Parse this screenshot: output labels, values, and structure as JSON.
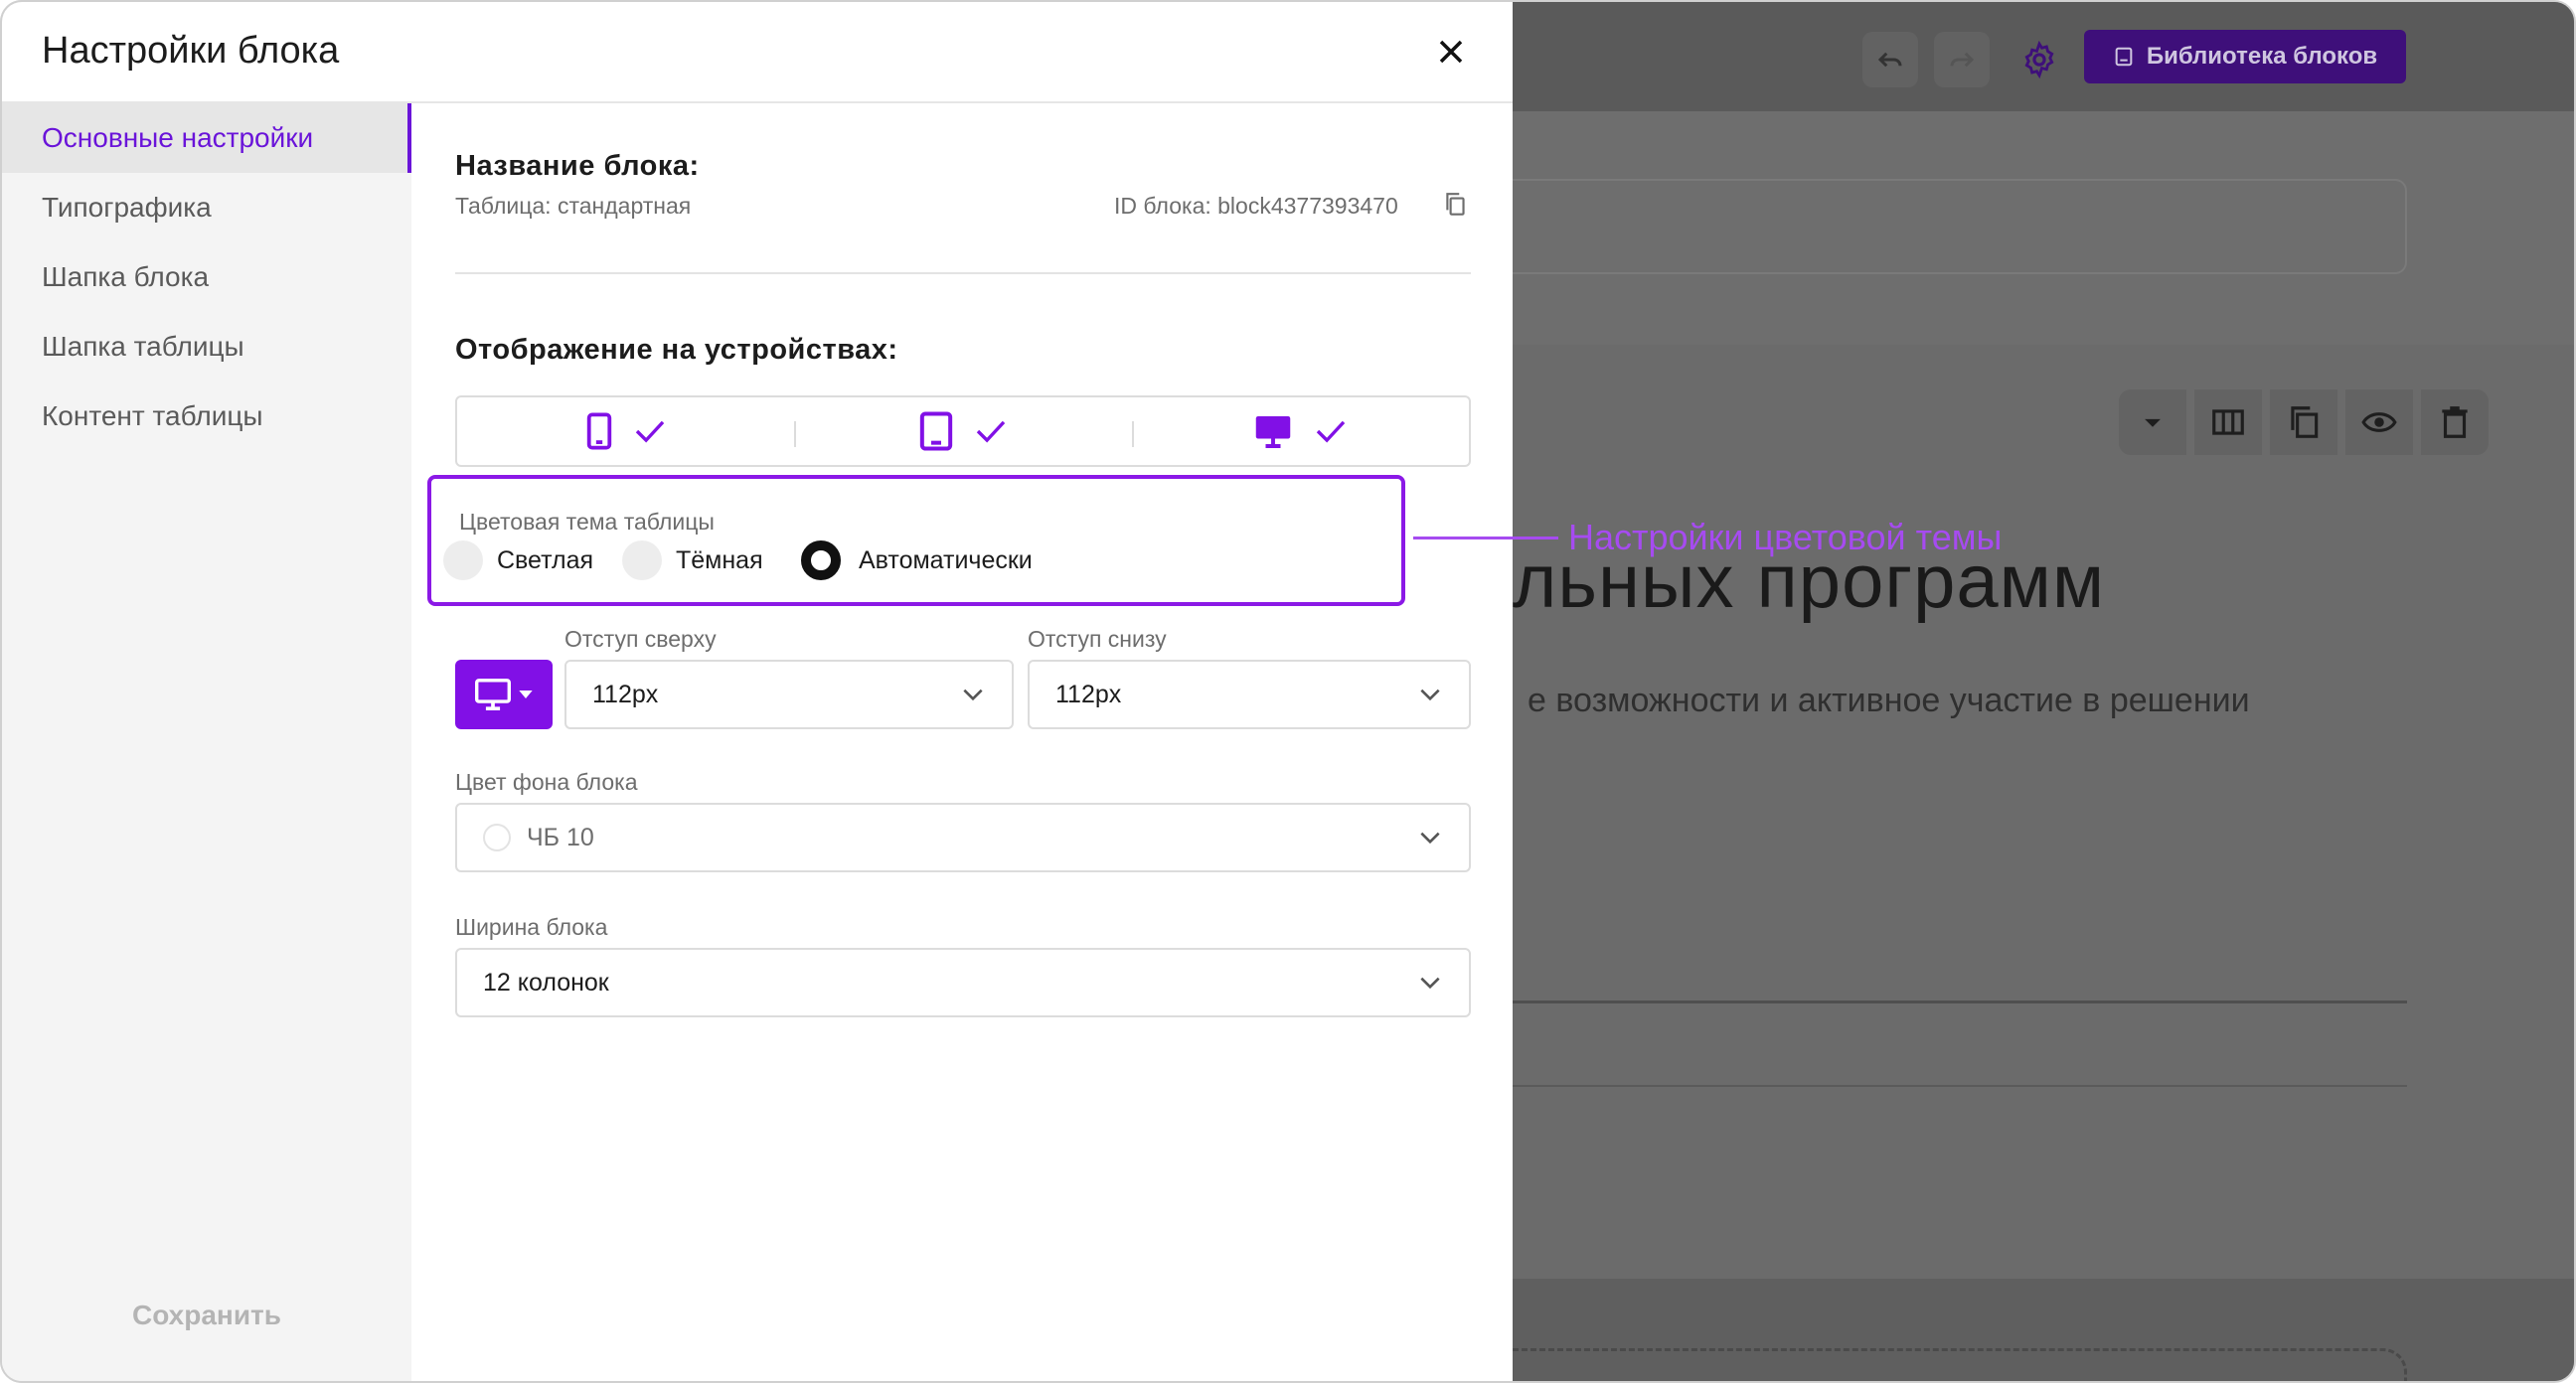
{
  "modal": {
    "title": "Настройки блока"
  },
  "sidebar": {
    "items": [
      {
        "label": "Основные настройки",
        "active": true
      },
      {
        "label": "Типографика",
        "active": false
      },
      {
        "label": "Шапка блока",
        "active": false
      },
      {
        "label": "Шапка таблицы",
        "active": false
      },
      {
        "label": "Контент таблицы",
        "active": false
      }
    ],
    "save_label": "Сохранить"
  },
  "block_info": {
    "name_title": "Название блока:",
    "name_value": "Таблица: стандартная",
    "id_text": "ID блока: block4377393470"
  },
  "devices": {
    "title": "Отображение на устройствах:",
    "items": [
      {
        "icon": "phone-icon",
        "checked": true
      },
      {
        "icon": "tablet-icon",
        "checked": true
      },
      {
        "icon": "desktop-icon",
        "checked": true
      }
    ]
  },
  "theme": {
    "label": "Цветовая тема таблицы",
    "options": [
      {
        "label": "Светлая",
        "selected": false
      },
      {
        "label": "Тёмная",
        "selected": false
      },
      {
        "label": "Автоматически",
        "selected": true
      }
    ]
  },
  "spacing": {
    "top_label": "Отступ сверху",
    "top_value": "112px",
    "bottom_label": "Отступ снизу",
    "bottom_value": "112px"
  },
  "background": {
    "label": "Цвет фона блока",
    "value": "ЧБ 10"
  },
  "width": {
    "label": "Ширина блока",
    "value": "12 колонок"
  },
  "annotation": {
    "text": "Настройки цветовой темы"
  },
  "background_page": {
    "library_button": "Библиотека блоков",
    "heading_fragment": "льных программ",
    "sub_fragment": "е возможности и активное участие в решении"
  },
  "colors": {
    "accent": "#8110e6",
    "accent_text": "#6a14d9",
    "annotation": "#a64bf0",
    "overlay": "#6e6e6e"
  }
}
